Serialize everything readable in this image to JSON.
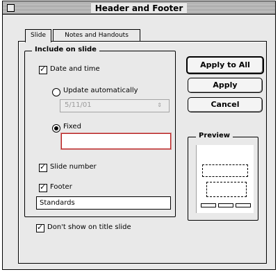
{
  "window": {
    "title": "Header and Footer"
  },
  "tabs": [
    {
      "label": "Slide",
      "active": true
    },
    {
      "label": "Notes and Handouts",
      "active": false
    }
  ],
  "include": {
    "group_label": "Include on slide",
    "date_time": {
      "label": "Date and time",
      "checked": true
    },
    "update_auto": {
      "label": "Update automatically",
      "selected": false,
      "date_value": "5/11/01"
    },
    "fixed": {
      "label": "Fixed",
      "selected": true,
      "value": ""
    },
    "slide_number": {
      "label": "Slide number",
      "checked": true
    },
    "footer": {
      "label": "Footer",
      "checked": true,
      "value": "Standards"
    }
  },
  "dont_show": {
    "label": "Don't show on title slide",
    "checked": true
  },
  "buttons": {
    "apply_all": "Apply to All",
    "apply": "Apply",
    "cancel": "Cancel"
  },
  "preview": {
    "label": "Preview"
  },
  "icons": {
    "checkmark": "checkmark-icon",
    "stepper": "stepper-arrows-icon"
  }
}
